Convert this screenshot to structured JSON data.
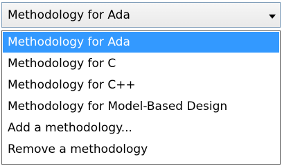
{
  "combo": {
    "selected_value": "Methodology for Ada",
    "arrow_icon": "chevron-down-icon"
  },
  "dropdown": {
    "items": [
      {
        "label": "Methodology for Ada",
        "selected": true
      },
      {
        "label": "Methodology for C",
        "selected": false
      },
      {
        "label": "Methodology for C++",
        "selected": false
      },
      {
        "label": "Methodology for Model-Based Design",
        "selected": false
      },
      {
        "label": "Add a methodology...",
        "selected": false
      },
      {
        "label": "Remove a methodology",
        "selected": false
      }
    ]
  },
  "colors": {
    "highlight": "#3399ff",
    "highlight_text": "#ffffff",
    "combo_border": "#7f9db9"
  }
}
